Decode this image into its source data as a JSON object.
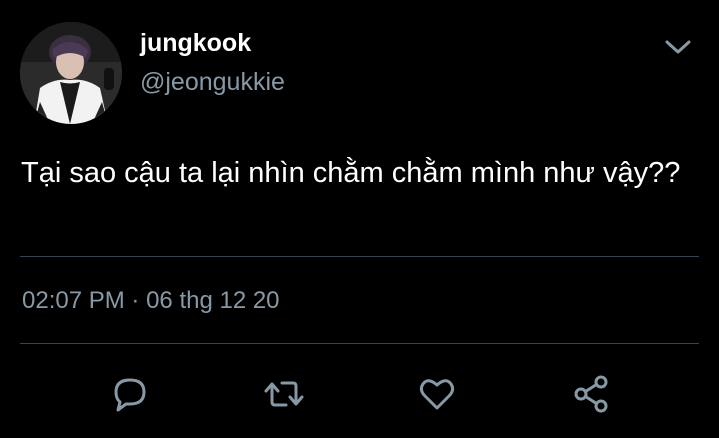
{
  "user": {
    "display_name": "jungkook",
    "handle": "@jeongukkie"
  },
  "tweet": {
    "text": "Tại sao cậu ta lại nhìn chằm chằm mình như vậy??",
    "time": "02:07 PM",
    "separator": "·",
    "date": "06 thg 12 20"
  },
  "icons": {
    "menu": "chevron-down-icon",
    "reply": "reply-icon",
    "retweet": "retweet-icon",
    "like": "heart-icon",
    "share": "share-icon"
  },
  "colors": {
    "background": "#000000",
    "primary_text": "#ffffff",
    "secondary_text": "#8899a6",
    "divider": "#38444d",
    "icon": "#8899a6"
  }
}
